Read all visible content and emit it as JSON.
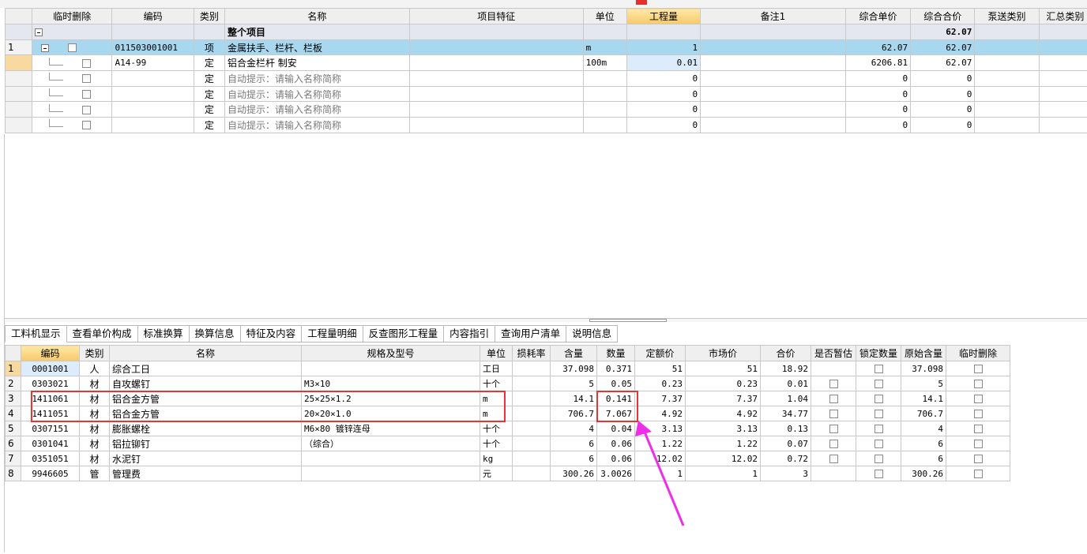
{
  "top_grid": {
    "headers": [
      "",
      "临时删除",
      "编码",
      "类别",
      "名称",
      "项目特征",
      "单位",
      "工程量",
      "备注1",
      "综合单价",
      "综合合价",
      "泵送类别",
      "汇总类别"
    ],
    "group_row": {
      "name": "整个项目",
      "total": "62.07"
    },
    "main_row": {
      "index": "1",
      "code": "011503001001",
      "type": "项",
      "name": "金属扶手、栏杆、栏板",
      "unit": "m",
      "qty": "1",
      "unit_price": "62.07",
      "total_price": "62.07"
    },
    "sub_rows": [
      {
        "code": "A14-99",
        "type": "定",
        "name": "铝合金栏杆 制安",
        "unit": "100m",
        "qty": "0.01",
        "unit_price": "6206.81",
        "total_price": "62.07"
      },
      {
        "code": "",
        "type": "定",
        "name": "自动提示：请输入名称简称",
        "unit": "",
        "qty": "0",
        "unit_price": "0",
        "total_price": "0"
      },
      {
        "code": "",
        "type": "定",
        "name": "自动提示：请输入名称简称",
        "unit": "",
        "qty": "0",
        "unit_price": "0",
        "total_price": "0"
      },
      {
        "code": "",
        "type": "定",
        "name": "自动提示：请输入名称简称",
        "unit": "",
        "qty": "0",
        "unit_price": "0",
        "total_price": "0"
      },
      {
        "code": "",
        "type": "定",
        "name": "自动提示：请输入名称简称",
        "unit": "",
        "qty": "0",
        "unit_price": "0",
        "total_price": "0"
      }
    ]
  },
  "tabs": [
    "工料机显示",
    "查看单价构成",
    "标准换算",
    "换算信息",
    "特征及内容",
    "工程量明细",
    "反查图形工程量",
    "内容指引",
    "查询用户清单",
    "说明信息"
  ],
  "bottom_grid": {
    "headers": [
      "",
      "编码",
      "类别",
      "名称",
      "规格及型号",
      "单位",
      "损耗率",
      "含量",
      "数量",
      "定额价",
      "市场价",
      "合价",
      "是否暂估",
      "锁定数量",
      "原始含量",
      "临时删除"
    ],
    "rows": [
      {
        "idx": "1",
        "code": "0001001",
        "type": "人",
        "name": "综合工日",
        "spec": "",
        "unit": "工日",
        "loss": "",
        "content": "37.098",
        "qty": "0.371",
        "quota": "51",
        "market": "51",
        "total": "18.92",
        "estimate": false,
        "lock": true,
        "orig": "37.098",
        "del": true
      },
      {
        "idx": "2",
        "code": "0303021",
        "type": "材",
        "name": "自攻螺钉",
        "spec": "M3×10",
        "unit": "十个",
        "loss": "",
        "content": "5",
        "qty": "0.05",
        "quota": "0.23",
        "market": "0.23",
        "total": "0.01",
        "estimate": true,
        "lock": true,
        "orig": "5",
        "del": true
      },
      {
        "idx": "3",
        "code": "1411061",
        "type": "材",
        "name": "铝合金方管",
        "spec": "25×25×1.2",
        "unit": "m",
        "loss": "",
        "content": "14.1",
        "qty": "0.141",
        "quota": "7.37",
        "market": "7.37",
        "total": "1.04",
        "estimate": true,
        "lock": true,
        "orig": "14.1",
        "del": true
      },
      {
        "idx": "4",
        "code": "1411051",
        "type": "材",
        "name": "铝合金方管",
        "spec": "20×20×1.0",
        "unit": "m",
        "loss": "",
        "content": "706.7",
        "qty": "7.067",
        "quota": "4.92",
        "market": "4.92",
        "total": "34.77",
        "estimate": true,
        "lock": true,
        "orig": "706.7",
        "del": true
      },
      {
        "idx": "5",
        "code": "0307151",
        "type": "材",
        "name": "膨胀螺栓",
        "spec": "M6×80 镀锌连母",
        "unit": "十个",
        "loss": "",
        "content": "4",
        "qty": "0.04",
        "quota": "3.13",
        "market": "3.13",
        "total": "0.13",
        "estimate": true,
        "lock": true,
        "orig": "4",
        "del": true
      },
      {
        "idx": "6",
        "code": "0301041",
        "type": "材",
        "name": "铝拉铆钉",
        "spec": "（综合）",
        "unit": "十个",
        "loss": "",
        "content": "6",
        "qty": "0.06",
        "quota": "1.22",
        "market": "1.22",
        "total": "0.07",
        "estimate": true,
        "lock": true,
        "orig": "6",
        "del": true
      },
      {
        "idx": "7",
        "code": "0351051",
        "type": "材",
        "name": "水泥钉",
        "spec": "",
        "unit": "kg",
        "loss": "",
        "content": "6",
        "qty": "0.06",
        "quota": "12.02",
        "market": "12.02",
        "total": "0.72",
        "estimate": true,
        "lock": true,
        "orig": "6",
        "del": true
      },
      {
        "idx": "8",
        "code": "9946605",
        "type": "管",
        "name": "管理费",
        "spec": "",
        "unit": "元",
        "loss": "",
        "content": "300.26",
        "qty": "3.0026",
        "quota": "1",
        "market": "1",
        "total": "3",
        "estimate": false,
        "lock": true,
        "orig": "300.26",
        "del": true
      }
    ]
  },
  "annotation": {
    "color": "#e8352f",
    "arrow_color": "#ee2ee8"
  }
}
